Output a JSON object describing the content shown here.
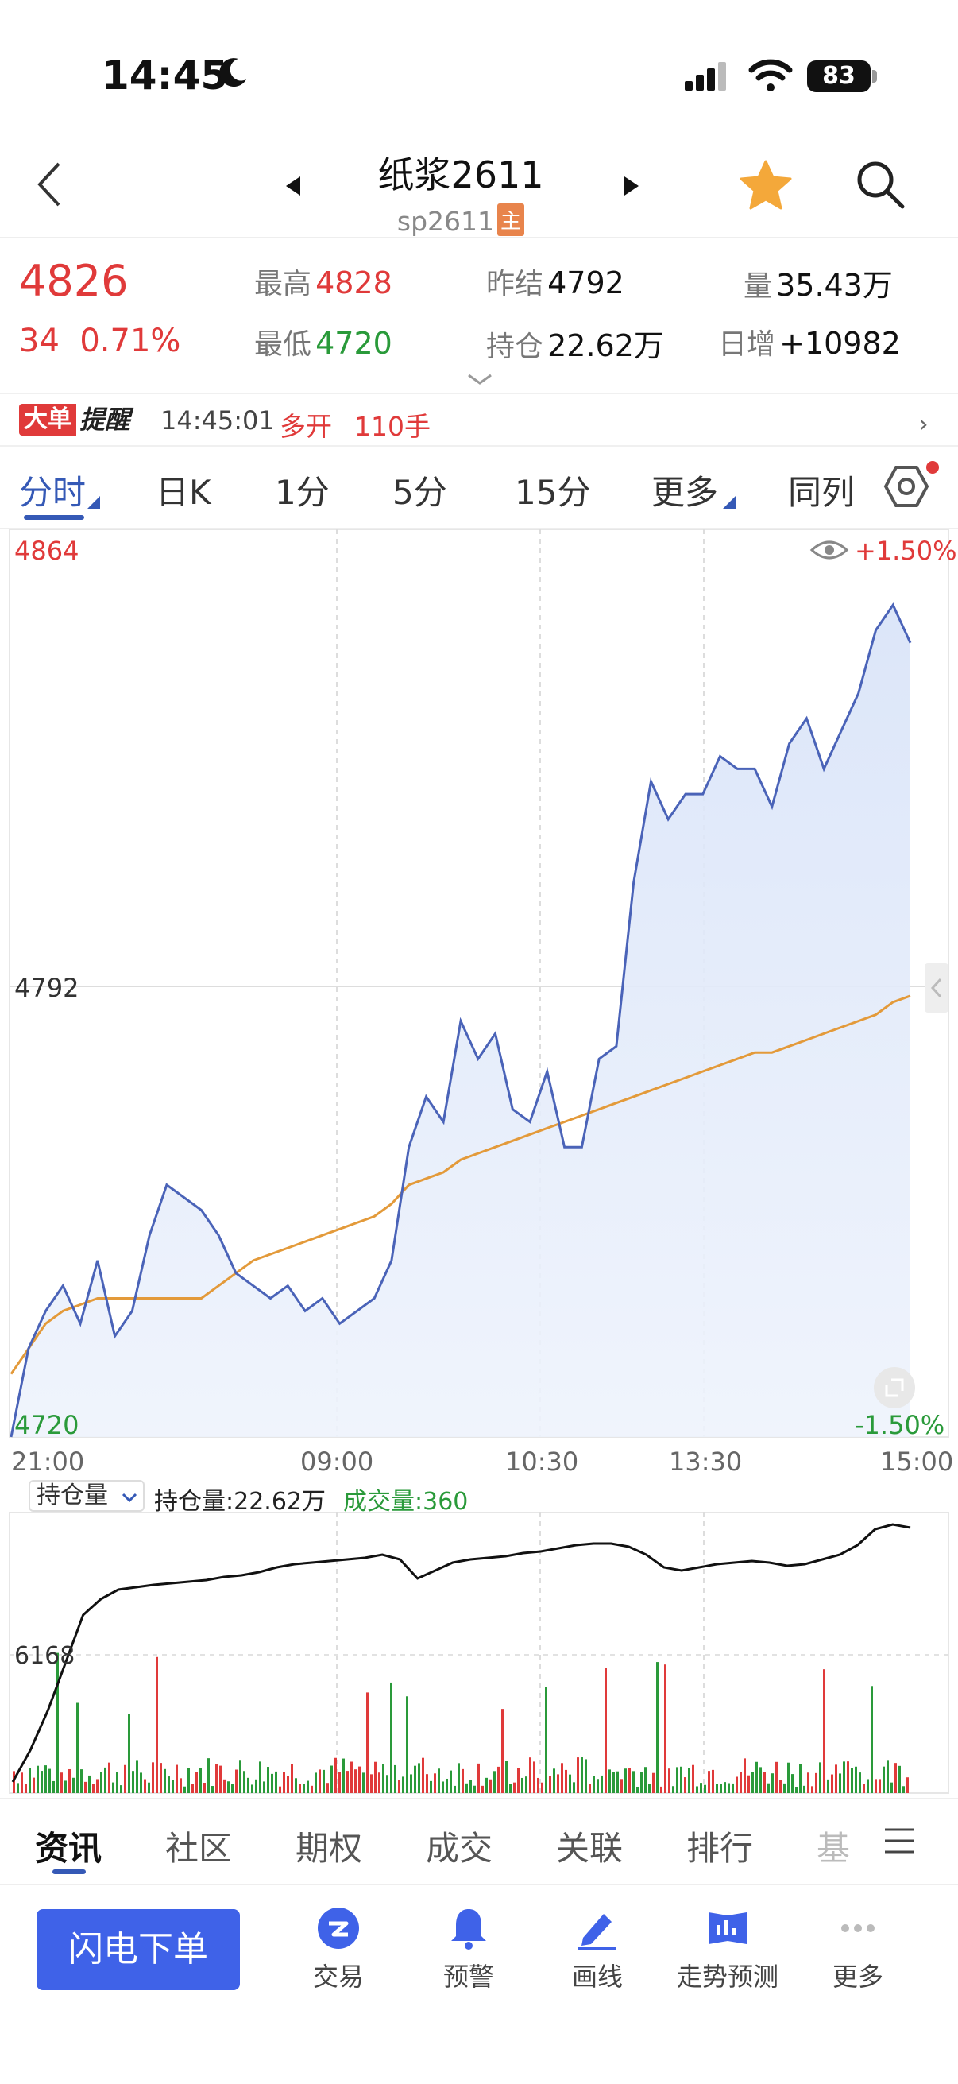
{
  "status_bar": {
    "time": "14:45",
    "battery": "83"
  },
  "header": {
    "title": "纸浆2611",
    "code": "sp2611",
    "main_tag": "主"
  },
  "quote": {
    "price": "4826",
    "change": "34",
    "change_pct": "0.71%",
    "high_label": "最高",
    "high": "4828",
    "low_label": "最低",
    "low": "4720",
    "prev_settle_label": "昨结",
    "prev_settle": "4792",
    "open_interest_label": "持仓",
    "open_interest": "22.62万",
    "volume_label": "量",
    "volume": "35.43万",
    "daily_increase_label": "日增",
    "daily_increase": "+10982"
  },
  "alert": {
    "badge": "大单",
    "badge2": "提醒",
    "time": "14:45:01",
    "action": "多开",
    "lots": "110手"
  },
  "tabs": [
    "分时",
    "日K",
    "1分",
    "5分",
    "15分",
    "更多",
    "同列"
  ],
  "chart_labels": {
    "top_price": "4864",
    "top_pct": "+1.50%",
    "mid_price": "4792",
    "bottom_price": "4720",
    "bottom_pct": "-1.50%",
    "times": [
      "21:00",
      "09:00",
      "10:30",
      "13:30",
      "15:00"
    ],
    "oi_select": "持仓量",
    "oi_value_text": "持仓量:22.62万",
    "volume_text": "成交量:360",
    "sub_level": "6168"
  },
  "colors": {
    "price_line": "#4a63b8",
    "avg_line": "#e39a3a",
    "up": "#e03a3a",
    "down": "#2a9a3a",
    "accent": "#3f62e8"
  },
  "chart_data": {
    "type": "line",
    "title": "",
    "x_ticks": [
      "21:00",
      "09:00",
      "10:30",
      "13:30",
      "15:00"
    ],
    "ylim": [
      4720,
      4864
    ],
    "y_ticks": [
      4720,
      4792,
      4864
    ],
    "series": [
      {
        "values": [
          4720,
          4734,
          4740,
          4744,
          4738,
          4748,
          4736,
          4740,
          4752,
          4760,
          4758,
          4756,
          4752,
          4746,
          4744,
          4742,
          4744,
          4740,
          4742,
          4738,
          4740,
          4742,
          4748,
          4766,
          4774,
          4770,
          4786,
          4780,
          4784,
          4772,
          4770,
          4778,
          4766,
          4766,
          4780,
          4782,
          4808,
          4824,
          4818,
          4822,
          4822,
          4828,
          4826,
          4826,
          4820,
          4830,
          4834,
          4826,
          4832,
          4838,
          4848,
          4852,
          4846
        ]
      },
      {
        "values": [
          4730,
          4734,
          4738,
          4740,
          4741,
          4742,
          4742,
          4742,
          4742,
          4742,
          4742,
          4742,
          4744,
          4746,
          4748,
          4749,
          4750,
          4751,
          4752,
          4753,
          4754,
          4755,
          4757,
          4760,
          4761,
          4762,
          4764,
          4765,
          4766,
          4767,
          4768,
          4769,
          4770,
          4771,
          4772,
          4773,
          4774,
          4775,
          4776,
          4777,
          4778,
          4779,
          4780,
          4781,
          4781,
          4782,
          4783,
          4784,
          4785,
          4786,
          4787,
          4789,
          4790
        ]
      }
    ]
  }
}
